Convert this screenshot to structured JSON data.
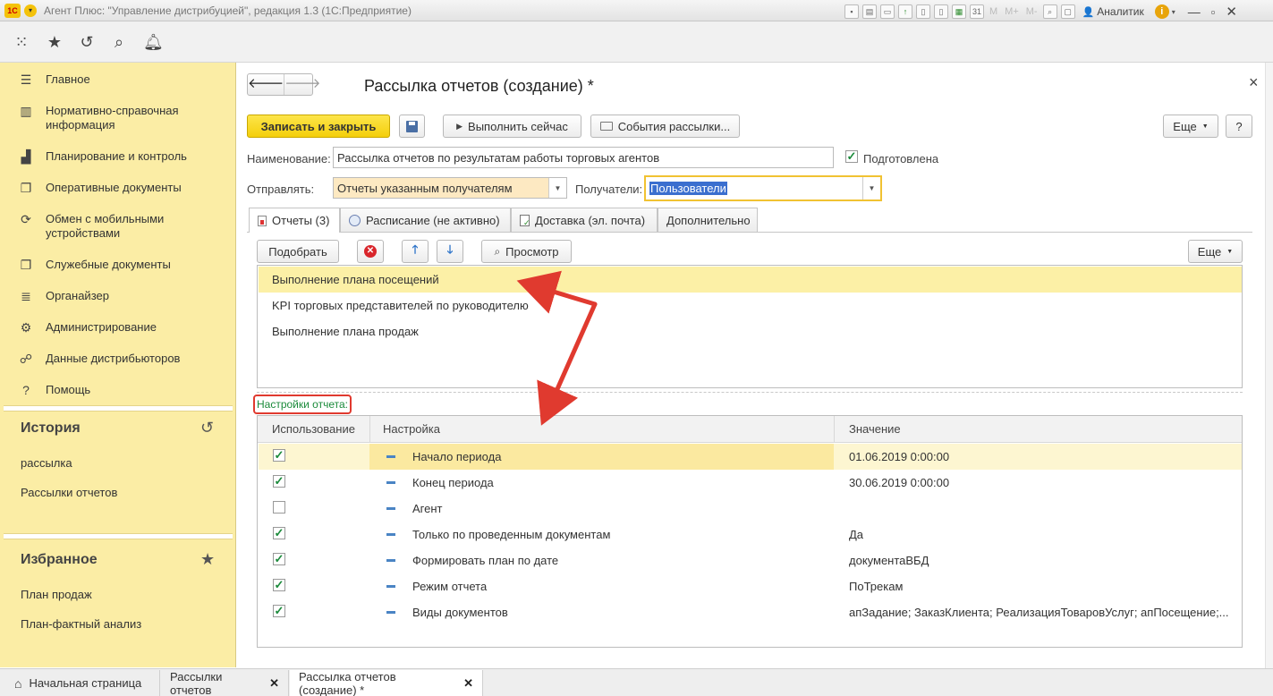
{
  "window": {
    "title": "Агент Плюс: \"Управление дистрибуцией\", редакция 1.3  (1С:Предприятие)",
    "user": "Аналитик",
    "calc_buttons": [
      "M",
      "M+",
      "M-"
    ]
  },
  "nav": {
    "items": [
      {
        "label": "Главное",
        "icon": "menu-lines-icon"
      },
      {
        "label": "Нормативно-справочная информация",
        "icon": "catalog-icon"
      },
      {
        "label": "Планирование и контроль",
        "icon": "bar-chart-icon"
      },
      {
        "label": "Оперативные документы",
        "icon": "documents-icon"
      },
      {
        "label": "Обмен с мобильными устройствами",
        "icon": "sync-icon"
      },
      {
        "label": "Служебные документы",
        "icon": "service-docs-icon"
      },
      {
        "label": "Органайзер",
        "icon": "organizer-icon"
      },
      {
        "label": "Администрирование",
        "icon": "gear-icon"
      },
      {
        "label": "Данные дистрибьюторов",
        "icon": "distributor-icon"
      },
      {
        "label": "Помощь",
        "icon": "question-icon"
      }
    ],
    "history_title": "История",
    "history_links": [
      "рассылка",
      "Рассылки отчетов"
    ],
    "favorites_title": "Избранное",
    "favorites_links": [
      "План продаж",
      "План-фактный анализ"
    ]
  },
  "form": {
    "title": "Рассылка отчетов (создание) *",
    "close_label": "×",
    "save_close_label": "Записать и закрыть",
    "run_now_label": "Выполнить сейчас",
    "events_label": "События рассылки...",
    "more_label": "Еще",
    "help_label": "?",
    "name_label": "Наименование:",
    "name_value": "Рассылка отчетов по результатам работы торговых агентов",
    "prepared_label": "Подготовлена",
    "prepared_checked": true,
    "send_label": "Отправлять:",
    "send_value": "Отчеты указанным получателям",
    "recipients_label": "Получатели:",
    "recipients_value": "Пользователи"
  },
  "tabs": [
    {
      "label": "Отчеты (3)",
      "icon": "report-icon",
      "active": true
    },
    {
      "label": "Расписание (не активно)",
      "icon": "schedule-icon",
      "active": false
    },
    {
      "label": "Доставка (эл. почта)",
      "icon": "delivery-icon",
      "active": false
    },
    {
      "label": "Дополнительно",
      "icon": "",
      "active": false
    }
  ],
  "reports_toolbar": {
    "pick_label": "Подобрать",
    "preview_label": "Просмотр",
    "more_label": "Еще"
  },
  "reports": [
    "Выполнение плана посещений",
    "KPI торговых представителей по руководителю",
    "Выполнение плана продаж"
  ],
  "settings": {
    "title": "Настройки отчета:",
    "columns": [
      "Использование",
      "Настройка",
      "Значение"
    ],
    "rows": [
      {
        "use": true,
        "name": "Начало периода",
        "value": "01.06.2019 0:00:00"
      },
      {
        "use": true,
        "name": "Конец периода",
        "value": "30.06.2019 0:00:00"
      },
      {
        "use": false,
        "name": "Агент",
        "value": ""
      },
      {
        "use": true,
        "name": "Только по проведенным документам",
        "value": "Да"
      },
      {
        "use": true,
        "name": "Формировать план по дате",
        "value": "документаВБД"
      },
      {
        "use": true,
        "name": "Режим отчета",
        "value": "ПоТрекам"
      },
      {
        "use": true,
        "name": "Виды документов",
        "value": "апЗадание; ЗаказКлиента; РеализацияТоваровУслуг; апПосещение;..."
      }
    ]
  },
  "bottom_tabs": [
    {
      "label": "Начальная страница"
    },
    {
      "label": "Рассылки отчетов"
    },
    {
      "label": "Рассылка отчетов (создание) *"
    }
  ],
  "colors": {
    "accent_yellow": "#fbeda5",
    "primary_button": "#f4cf0b",
    "selected_row": "#fcf0a6",
    "annotation_red": "#e03a2f",
    "settings_title_green": "#1a8a3a"
  }
}
